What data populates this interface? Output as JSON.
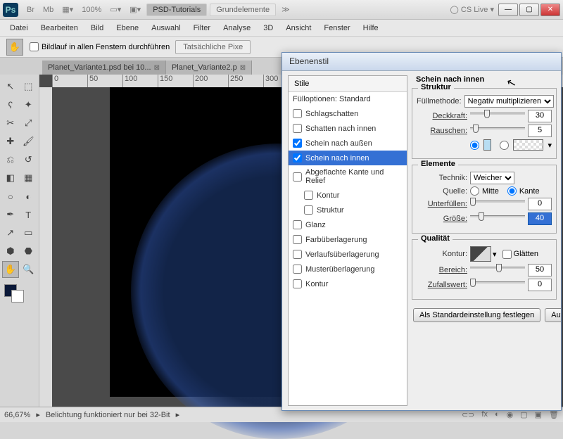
{
  "titlebar": {
    "ps": "Ps",
    "br": "Br",
    "mb": "Mb",
    "zoom": "100%",
    "btn1": "PSD-Tutorials",
    "btn2": "Grundelemente",
    "cslive": "CS Live"
  },
  "menu": [
    "Datei",
    "Bearbeiten",
    "Bild",
    "Ebene",
    "Auswahl",
    "Filter",
    "Analyse",
    "3D",
    "Ansicht",
    "Fenster",
    "Hilfe"
  ],
  "options": {
    "scroll_all": "Bildlauf in allen Fenstern durchführen",
    "actual": "Tatsächliche Pixe"
  },
  "tabs": [
    {
      "label": "Planet_Variante1.psd bei 10...",
      "active": true
    },
    {
      "label": "Planet_Variante2.p",
      "active": false
    }
  ],
  "ruler": [
    "0",
    "50",
    "100",
    "150",
    "200",
    "250",
    "300"
  ],
  "status": {
    "zoom": "66,67%",
    "msg": "Belichtung funktioniert nur bei 32-Bit"
  },
  "dialog": {
    "title": "Ebenenstil",
    "styles_header": "Stile",
    "blend_options": "Fülloptionen: Standard",
    "items": [
      {
        "label": "Schlagschatten",
        "checked": false
      },
      {
        "label": "Schatten nach innen",
        "checked": false
      },
      {
        "label": "Schein nach außen",
        "checked": true
      },
      {
        "label": "Schein nach innen",
        "checked": true,
        "selected": true
      },
      {
        "label": "Abgeflachte Kante und Relief",
        "checked": false
      },
      {
        "label": "Kontur",
        "checked": false,
        "indent": true
      },
      {
        "label": "Struktur",
        "checked": false,
        "indent": true
      },
      {
        "label": "Glanz",
        "checked": false
      },
      {
        "label": "Farbüberlagerung",
        "checked": false
      },
      {
        "label": "Verlaufsüberlagerung",
        "checked": false
      },
      {
        "label": "Musterüberlagerung",
        "checked": false
      },
      {
        "label": "Kontur",
        "checked": false
      }
    ],
    "heading": "Schein nach innen",
    "struktur": {
      "legend": "Struktur",
      "fillmode_lbl": "Füllmethode:",
      "fillmode_val": "Negativ multiplizieren",
      "opacity_lbl": "Deckkraft:",
      "opacity_val": "30",
      "noise_lbl": "Rauschen:",
      "noise_val": "5",
      "color": "#b8ddf2"
    },
    "elemente": {
      "legend": "Elemente",
      "technik_lbl": "Technik:",
      "technik_val": "Weicher",
      "quelle_lbl": "Quelle:",
      "quelle_mitte": "Mitte",
      "quelle_kante": "Kante",
      "underfill_lbl": "Unterfüllen:",
      "underfill_val": "0",
      "size_lbl": "Größe:",
      "size_val": "40"
    },
    "qualitaet": {
      "legend": "Qualität",
      "kontur_lbl": "Kontur:",
      "smooth_lbl": "Glätten",
      "range_lbl": "Bereich:",
      "range_val": "50",
      "jitter_lbl": "Zufallswert:",
      "jitter_val": "0"
    },
    "btn_default": "Als Standardeinstellung festlegen",
    "btn_reset": "Auf Stan"
  }
}
